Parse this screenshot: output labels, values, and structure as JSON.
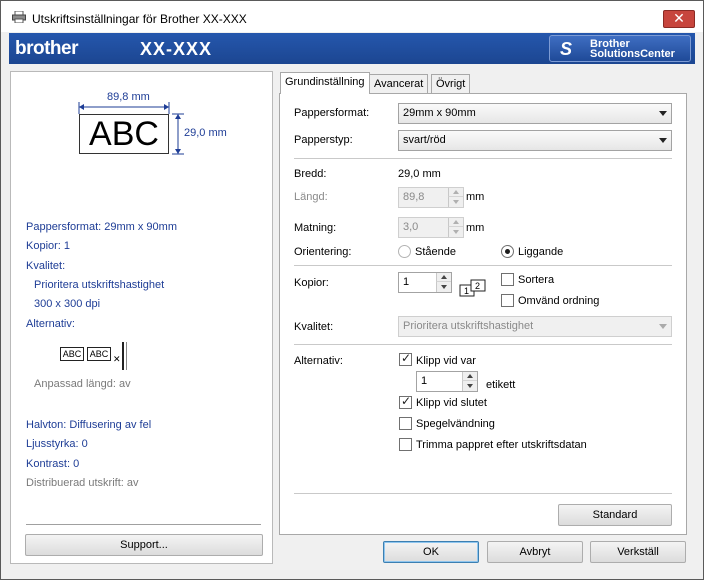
{
  "window": {
    "title": "Utskriftsinställningar för Brother XX-XXX",
    "close_label": "✕"
  },
  "banner": {
    "logo": "brother",
    "model": "XX-XXX",
    "solutions_center_line1": "Brother",
    "solutions_center_line2": "SolutionsCenter"
  },
  "preview": {
    "width_dim": "89,8 mm",
    "height_dim": "29,0 mm",
    "sample_text": "ABC",
    "mini_label": "ABC"
  },
  "summary": {
    "paper_format": "Pappersformat: 29mm x 90mm",
    "copies": "Kopior: 1",
    "quality": "Kvalitet:",
    "quality_value": "Prioritera utskriftshastighet",
    "dpi": "300 x 300 dpi",
    "options": "Alternativ:",
    "custom_length": "Anpassad längd: av",
    "halftone": "Halvton: Diffusering av fel",
    "brightness": "Ljusstyrka:   0",
    "contrast": "Kontrast:   0",
    "distributed": "Distribuerad utskrift: av"
  },
  "buttons": {
    "support": "Support...",
    "standard": "Standard",
    "ok": "OK",
    "cancel": "Avbryt",
    "apply": "Verkställ"
  },
  "tabs": [
    "Grundinställning",
    "Avancerat",
    "Övrigt"
  ],
  "form": {
    "paper_format_label": "Pappersformat:",
    "paper_format_value": "29mm x 90mm",
    "paper_type_label": "Papperstyp:",
    "paper_type_value": "svart/röd",
    "width_label": "Bredd:",
    "width_value": "29,0 mm",
    "length_label": "Längd:",
    "length_value": "89,8",
    "length_unit": "mm",
    "feed_label": "Matning:",
    "feed_value": "3,0",
    "feed_unit": "mm",
    "orientation_label": "Orientering:",
    "portrait": "Stående",
    "landscape": "Liggande",
    "copies_label": "Kopior:",
    "copies_value": "1",
    "collate": "Sortera",
    "reverse": "Omvänd ordning",
    "quality_label": "Kvalitet:",
    "quality_value": "Prioritera utskriftshastighet",
    "options_label": "Alternativ:",
    "cut_every": "Klipp vid var",
    "cut_every_value": "1",
    "cut_every_unit": "etikett",
    "cut_at_end": "Klipp vid slutet",
    "mirror": "Spegelvändning",
    "trim": "Trimma pappret efter utskriftsdatan"
  },
  "colors": {
    "banner_blue": "#1c4691",
    "info_blue": "#1e3d96"
  }
}
